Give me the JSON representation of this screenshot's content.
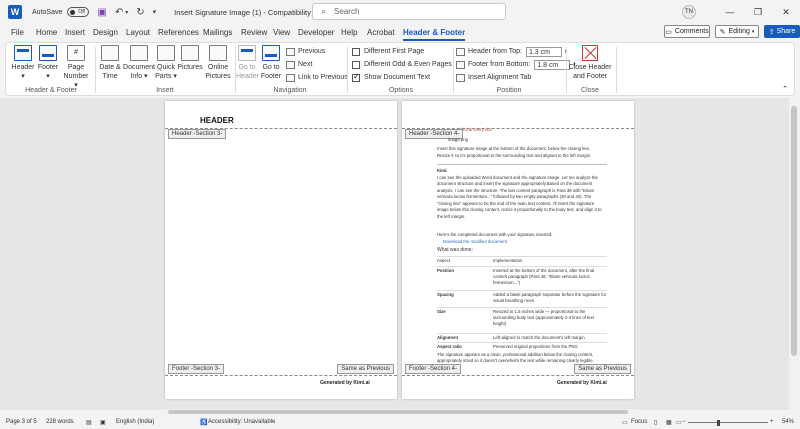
{
  "titlebar": {
    "autosave_label": "AutoSave",
    "autosave_state": "Off",
    "doc_title": "Insert Signature Image (1) - Compatibility Mo...",
    "search_placeholder": "Search",
    "user_initials": "TN"
  },
  "menu": {
    "tabs": [
      "File",
      "Home",
      "Insert",
      "Design",
      "Layout",
      "References",
      "Mailings",
      "Review",
      "View",
      "Developer",
      "Help",
      "Acrobat",
      "Header & Footer"
    ],
    "active_tab": "Header & Footer",
    "comments_label": "Comments",
    "editing_label": "Editing",
    "share_label": "Share"
  },
  "ribbon": {
    "header_label": "Header",
    "footer_label": "Footer",
    "page_number_label1": "Page",
    "page_number_label2": "Number",
    "group_header_footer": "Header & Footer",
    "date_time_label1": "Date &",
    "date_time_label2": "Time",
    "doc_info_label1": "Document",
    "doc_info_label2": "Info",
    "quick_parts_label1": "Quick",
    "quick_parts_label2": "Parts",
    "pictures_label": "Pictures",
    "online_pictures_label1": "Online",
    "online_pictures_label2": "Pictures",
    "group_insert": "Insert",
    "goto_header_label1": "Go to",
    "goto_header_label2": "Header",
    "goto_footer_label1": "Go to",
    "goto_footer_label2": "Footer",
    "previous_label": "Previous",
    "next_label": "Next",
    "link_previous_label": "Link to Previous",
    "group_navigation": "Navigation",
    "different_first_page": "Different First Page",
    "different_odd_even": "Different Odd & Even Pages",
    "show_document_text": "Show Document Text",
    "group_options": "Options",
    "header_from_top_label": "Header from Top:",
    "header_from_top_value": "1.3 cm",
    "footer_from_bottom_label": "Footer from Bottom:",
    "footer_from_bottom_value": "1.8 cm",
    "insert_alignment_tab": "Insert Alignment Tab",
    "group_position": "Position",
    "close_label1": "Close Header",
    "close_label2": "and Footer",
    "group_close": "Close"
  },
  "page1": {
    "header_tag": "Header -Section 3-",
    "header_text": "HEADER",
    "footer_tag": "Footer -Section 3-",
    "same_as_previous": "Same as Previous",
    "generated_by": "Generated by Kimi.ai"
  },
  "page2": {
    "header_tag": "Header -Section 4-",
    "footer_tag": "Footer -Section 4-",
    "same_as_previous": "Same as Previous",
    "generated_by": "Generated by Kimi.ai",
    "top_small": "kimi.ai every doc",
    "lines": [
      "image.png",
      "Insert this signature image at the bottom of the document, below the closing line.",
      "Resize it so it's proportional to the surrounding text and aligned to the left margin."
    ],
    "kimi_label": "Kimi:",
    "kimi_para": "I can see the uploaded Word document and the signature image. Let me analyze the document structure and insert the signature appropriately.Based on the document analysis, I can see the structure. The last content paragraph is Para 38 with \"Etiam vehicula luctus fermentum...\" followed by two empty paragraphs (39 and 40). The \"closing line\" appears to be the end of the main text content. I'll insert the signature image below this closing content, resize it proportionally to the body text, and align it to the left margin.",
    "completed": "Here's the completed document with your signature inserted:",
    "download_link": "Download the modified document",
    "what_was_done": "What was done:",
    "table_headers": [
      "Aspect",
      "Implementation"
    ],
    "table_rows": [
      {
        "aspect": "Position",
        "impl": "Inserted at the bottom of the document, after the final content paragraph (Para 38: \"Etiam vehicula luctus fermentum...\")"
      },
      {
        "aspect": "Spacing",
        "impl": "Added a blank paragraph separator before the signature for visual breathing room"
      },
      {
        "aspect": "Size",
        "impl": "Resized to 1.5 inches wide — proportional to the surrounding body text (approximately 2-3 lines of text height)"
      },
      {
        "aspect": "Alignment",
        "impl": "Left-aligned to match the document's left margin"
      },
      {
        "aspect": "Aspect ratio",
        "impl": "Preserved original proportions from the PNG"
      }
    ],
    "closing_para": "The signature appears as a clean, professional addition below the closing content, appropriately sized so it doesn't overwhelm the text while remaining clearly legible."
  },
  "status": {
    "page": "Page 3 of 5",
    "words": "228 words",
    "language": "English (India)",
    "accessibility": "Accessibility: Unavailable",
    "focus": "Focus",
    "zoom": "54%",
    "zoom_level": 0.54
  }
}
